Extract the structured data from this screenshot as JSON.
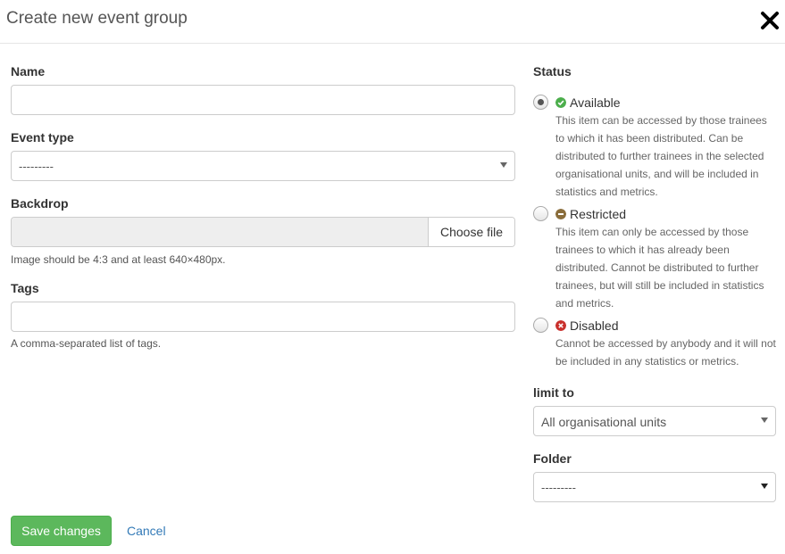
{
  "modal": {
    "title": "Create new event group"
  },
  "form": {
    "name": {
      "label": "Name",
      "value": "",
      "placeholder": ""
    },
    "event_type": {
      "label": "Event type",
      "selected": "---------"
    },
    "backdrop": {
      "label": "Backdrop",
      "button_label": "Choose file",
      "help": "Image should be 4:3 and at least 640×480px."
    },
    "tags": {
      "label": "Tags",
      "value": "",
      "help": "A comma-separated list of tags."
    }
  },
  "status": {
    "label": "Status",
    "options": [
      {
        "label": "Available",
        "icon": "check-circle-icon",
        "color": "#4cae4c",
        "checked": true,
        "description": "This item can be accessed by those trainees to which it has been distributed. Can be distributed to further trainees in the selected organisational units, and will be included in statistics and metrics."
      },
      {
        "label": "Restricted",
        "icon": "minus-circle-icon",
        "color": "#8a6d3b",
        "checked": false,
        "description": "This item can only be accessed by those trainees to which it has already been distributed. Cannot be distributed to further trainees, but will still be included in statistics and metrics."
      },
      {
        "label": "Disabled",
        "icon": "times-circle-icon",
        "color": "#c9302c",
        "checked": false,
        "description": "Cannot be accessed by anybody and it will not be included in any statistics or metrics."
      }
    ]
  },
  "limit_to": {
    "label": "limit to",
    "selected": "All organisational units"
  },
  "folder": {
    "label": "Folder",
    "selected": "---------"
  },
  "actions": {
    "save_label": "Save changes",
    "cancel_label": "Cancel"
  }
}
